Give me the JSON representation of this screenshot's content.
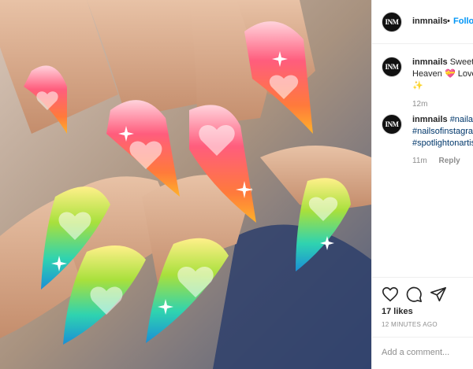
{
  "post": {
    "image_alt": "Stiletto nails with rainbow gradient and airbrushed hearts",
    "author": {
      "avatar_text": "INM",
      "username": "inmnails",
      "separator": "•",
      "follow_label": "Follow"
    }
  },
  "comments": [
    {
      "avatar_text": "INM",
      "username": "inmnails",
      "text_parts": [
        "Sweet",
        "Heaven 💝 Love",
        "✨"
      ],
      "time": "12m"
    },
    {
      "avatar_text": "INM",
      "username": "inmnails",
      "tags": [
        "#nailart",
        "#nailsofinstagram",
        "#spotlightonartists"
      ],
      "time": "11m",
      "reply_label": "Reply"
    }
  ],
  "actions": {
    "icons": [
      "heart-icon",
      "comment-icon",
      "share-icon"
    ],
    "likes": "17 likes",
    "time_ago": "12 MINUTES AGO"
  },
  "add_comment": {
    "placeholder": "Add a comment..."
  }
}
